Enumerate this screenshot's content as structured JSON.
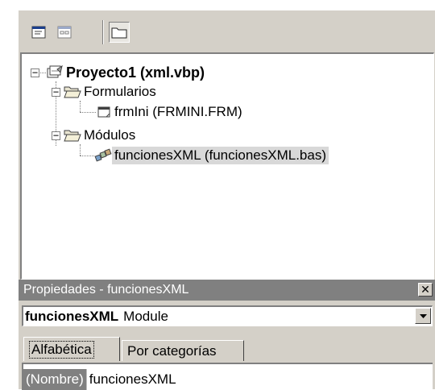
{
  "project_explorer": {
    "toolbar": {
      "view_code_icon": "view-code-icon",
      "view_object_icon": "view-object-icon",
      "toggle_folders_icon": "folder-icon"
    },
    "tree": {
      "project": {
        "label": "Proyecto1 (xml.vbp)",
        "expanded": true
      },
      "folders": [
        {
          "label": "Formularios",
          "expanded": true,
          "items": [
            {
              "label": "frmIni (FRMINI.FRM)",
              "icon": "form-icon"
            }
          ]
        },
        {
          "label": "Módulos",
          "expanded": true,
          "items": [
            {
              "label": "funcionesXML (funcionesXML.bas)",
              "icon": "module-icon",
              "selected": true
            }
          ]
        }
      ]
    }
  },
  "properties": {
    "title": "Propiedades - funcionesXML",
    "object_name": "funcionesXML",
    "object_type": "Module",
    "tabs": [
      "Alfabética",
      "Por categorías"
    ],
    "active_tab": 0,
    "rows": [
      {
        "name": "(Nombre)",
        "value": "funcionesXML"
      }
    ]
  },
  "colors": {
    "window_bg": "#d4d0c8",
    "title_inactive": "#808080",
    "selection": "#d8d8d8"
  }
}
